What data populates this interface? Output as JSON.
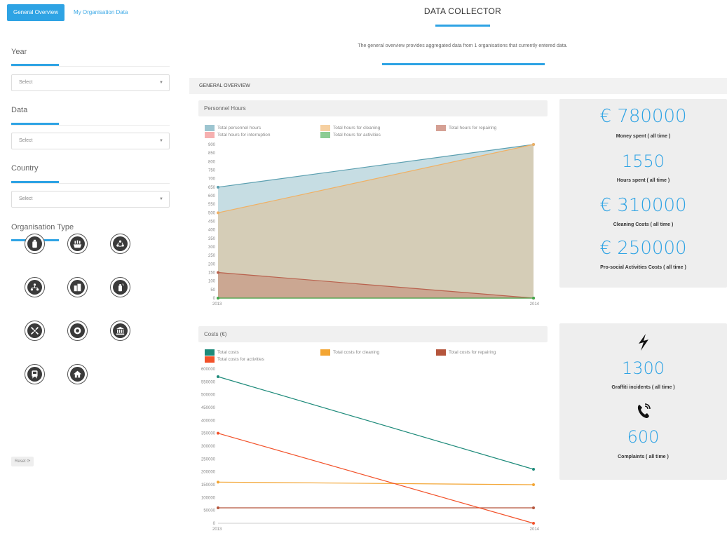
{
  "tabs": [
    {
      "label": "General Overview",
      "active": true
    },
    {
      "label": "My Organisation Data",
      "active": false
    }
  ],
  "header": {
    "title": "DATA COLLECTOR",
    "subtitle": "The general overview provides aggregated data from 1 organisations that currently entered data."
  },
  "sidebar": {
    "filters": [
      {
        "label": "Year",
        "value": "Select"
      },
      {
        "label": "Data",
        "value": "Select"
      },
      {
        "label": "Country",
        "value": "Select"
      }
    ],
    "org_type_label": "Organisation Type",
    "org_types": [
      "bottle-icon",
      "field-icon",
      "recycle-people-icon",
      "people-network-icon",
      "buildings-icon",
      "spray-can-icon",
      "compress-arrows-icon",
      "police-badge-icon",
      "bank-icon",
      "train-icon",
      "house-icon"
    ],
    "reset_label": "Reset"
  },
  "section_title": "GENERAL OVERVIEW",
  "charts": {
    "hours": {
      "title": "Personnel Hours"
    },
    "costs": {
      "title": "Costs (€)"
    }
  },
  "kpis": {
    "money_value": "€ 780000",
    "money_label": "Money spent ( all time )",
    "hours_value": "1550",
    "hours_label": "Hours spent ( all time )",
    "cleaning_value": "€ 310000",
    "cleaning_label": "Cleaning Costs ( all time )",
    "prosocial_value": "€ 250000",
    "prosocial_label": "Pro-social Activities Costs ( all time )",
    "graffiti_value": "1300",
    "graffiti_label": "Graffiti incidents ( all time )",
    "complaints_value": "600",
    "complaints_label": "Complaints ( all time )"
  },
  "chart_data": [
    {
      "type": "area",
      "title": "Personnel Hours",
      "x": [
        "2013",
        "2014"
      ],
      "ylim": [
        0,
        900
      ],
      "yticks": [
        0,
        50,
        100,
        150,
        200,
        250,
        300,
        350,
        400,
        450,
        500,
        550,
        600,
        650,
        700,
        750,
        800,
        850,
        900
      ],
      "series": [
        {
          "name": "Total personnel hours",
          "values": [
            650,
            900
          ],
          "color": "#5b9fb0"
        },
        {
          "name": "Total hours for cleaning",
          "values": [
            500,
            900
          ],
          "color": "#f0b063"
        },
        {
          "name": "Total hours for repairing",
          "values": [
            150,
            0
          ],
          "color": "#b9614d"
        },
        {
          "name": "Total hours for interruption",
          "values": [
            0,
            0
          ],
          "color": "#f07b7b"
        },
        {
          "name": "Total hours for activities",
          "values": [
            0,
            0
          ],
          "color": "#3faa4b"
        }
      ]
    },
    {
      "type": "line",
      "title": "Costs (€)",
      "x": [
        "2013",
        "2014"
      ],
      "ylim": [
        0,
        600000
      ],
      "yticks": [
        0,
        50000,
        100000,
        150000,
        200000,
        250000,
        300000,
        350000,
        400000,
        450000,
        500000,
        550000,
        600000
      ],
      "series": [
        {
          "name": "Total costs",
          "values": [
            570000,
            210000
          ],
          "color": "#1d8a7a"
        },
        {
          "name": "Total costs for cleaning",
          "values": [
            160000,
            150000
          ],
          "color": "#f3a533"
        },
        {
          "name": "Total costs for repairing",
          "values": [
            60000,
            60000
          ],
          "color": "#b5553c"
        },
        {
          "name": "Total costs for activities",
          "values": [
            350000,
            0
          ],
          "color": "#f2522a"
        }
      ]
    }
  ]
}
